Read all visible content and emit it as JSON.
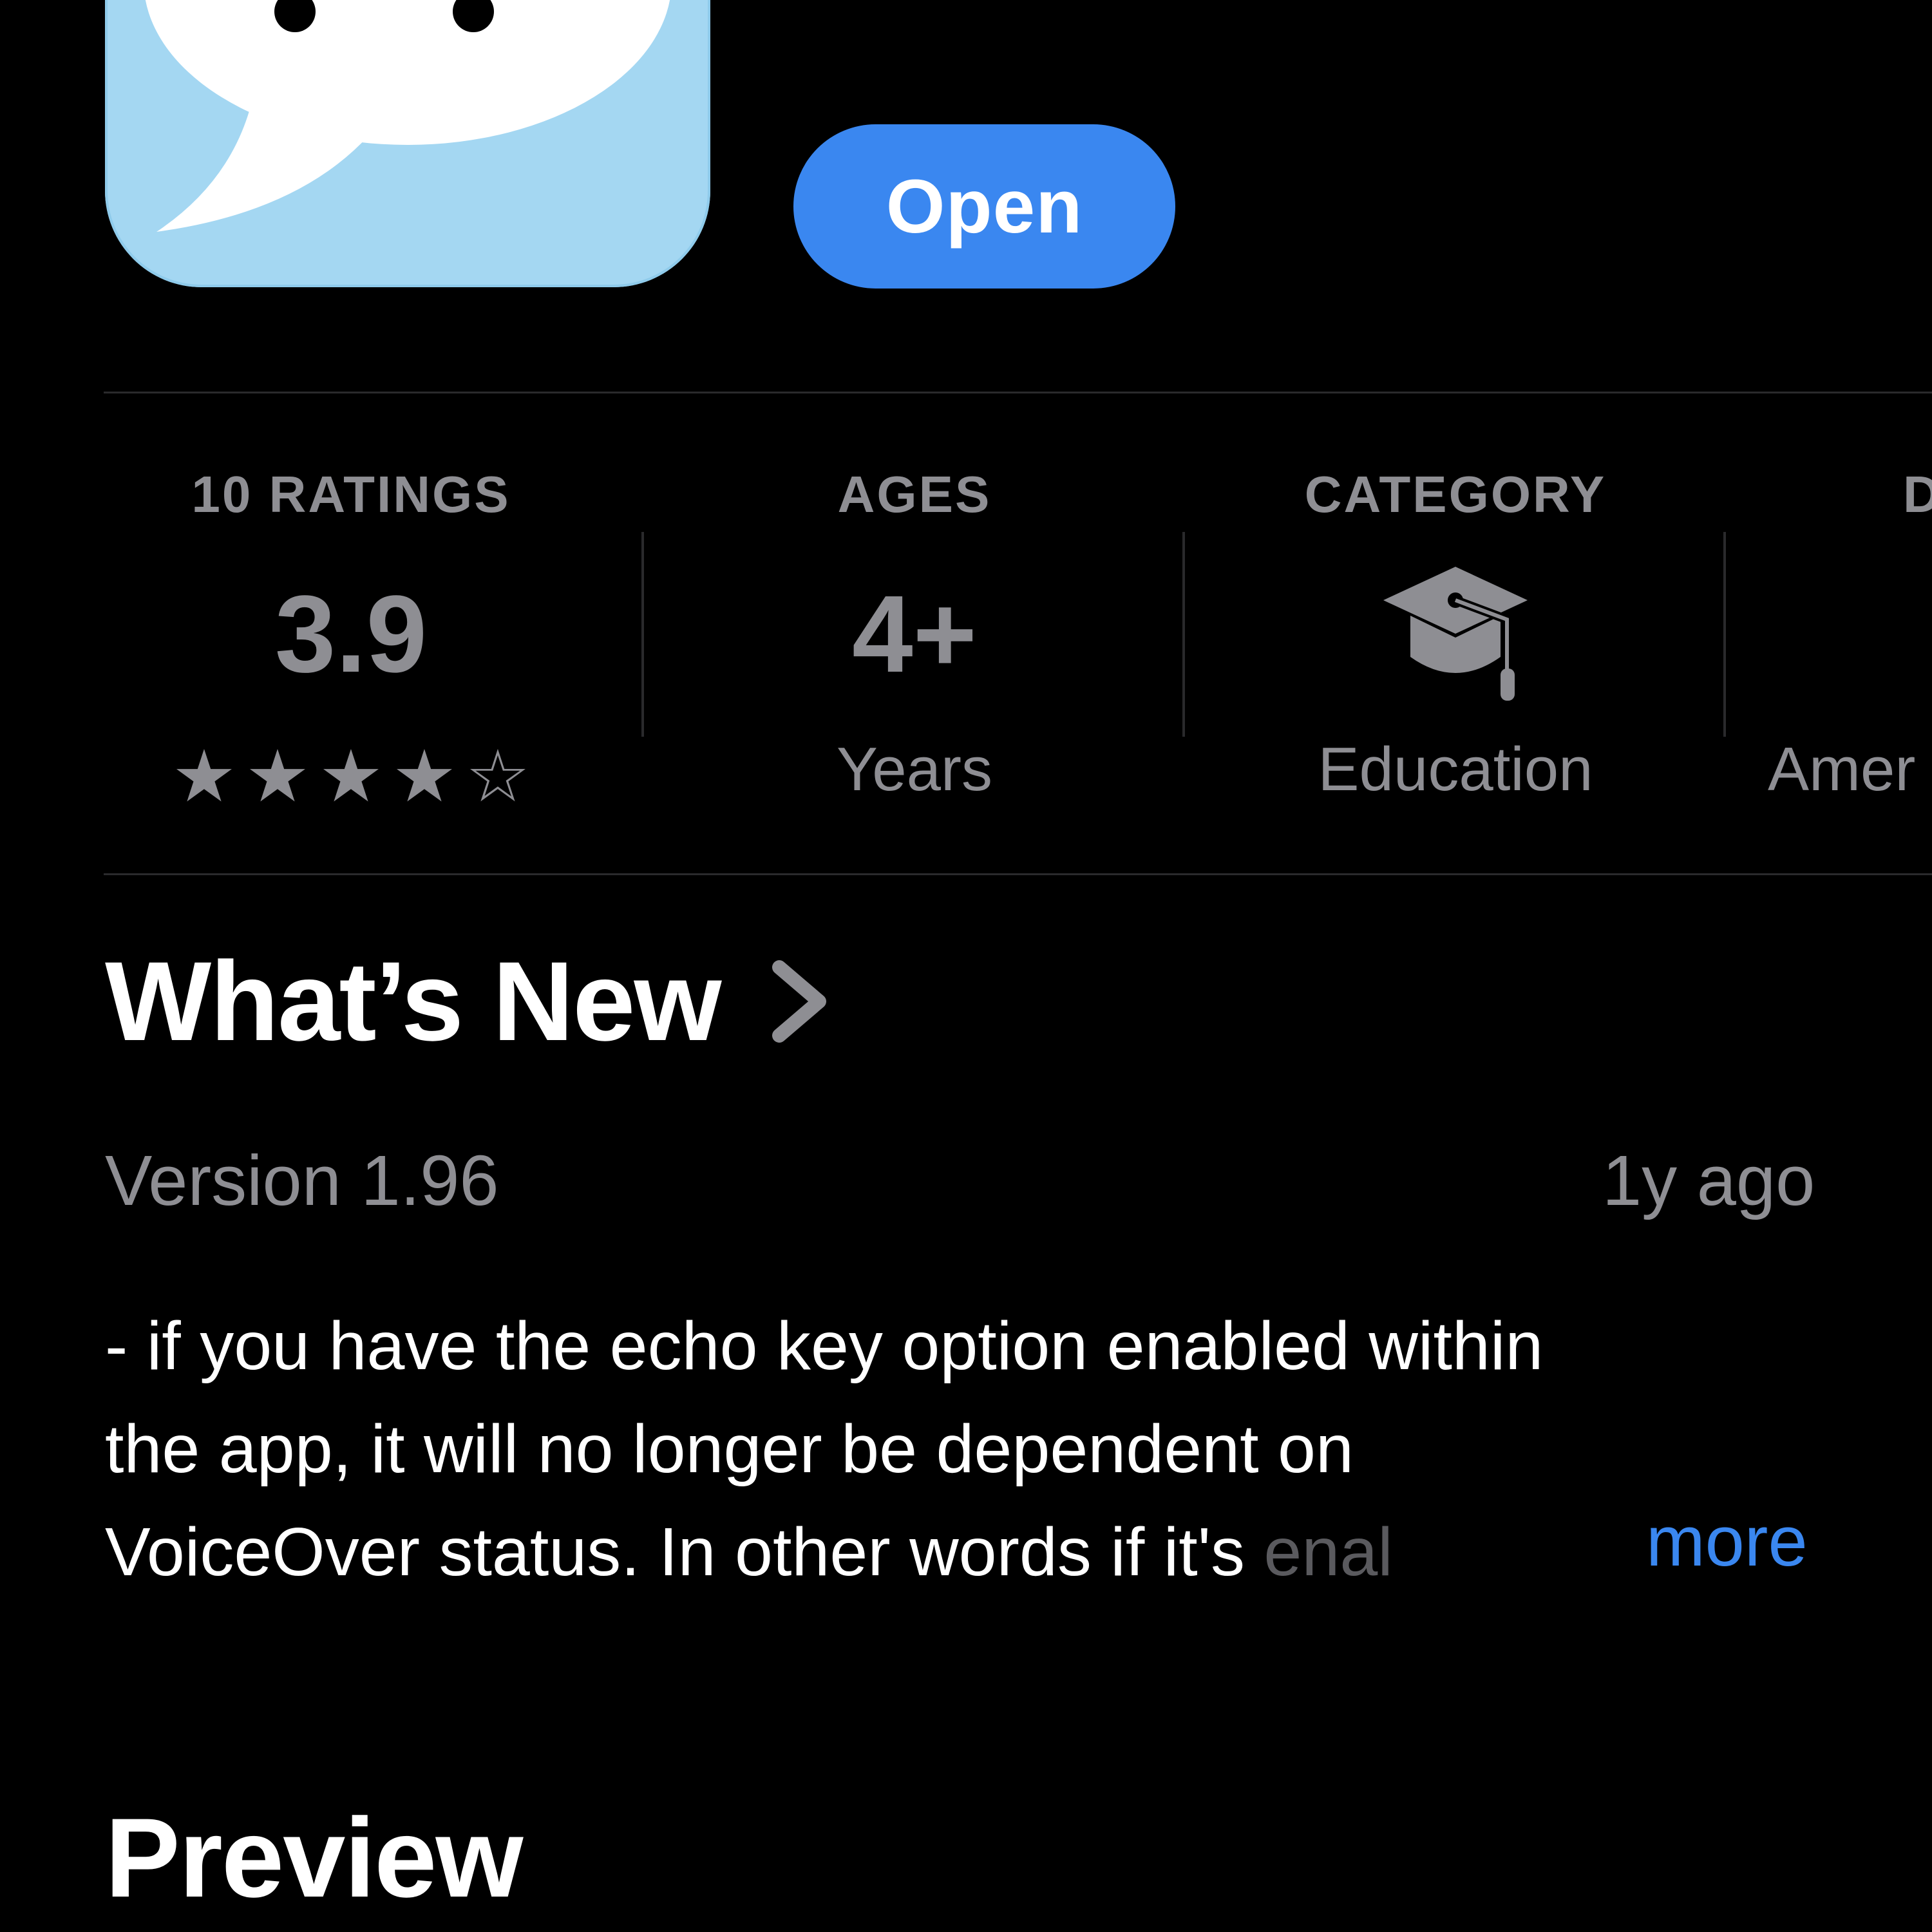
{
  "app": {
    "open_label": "Open"
  },
  "info": {
    "ratings": {
      "header": "10 RATINGS",
      "value": "3.9",
      "stars_filled": 4,
      "stars_total": 5
    },
    "ages": {
      "header": "AGES",
      "value": "4+",
      "sub": "Years"
    },
    "category": {
      "header": "CATEGORY",
      "icon": "graduation-cap-icon",
      "sub": "Education"
    },
    "developer": {
      "header": "D",
      "sub": "Amer"
    }
  },
  "whats_new": {
    "title": "What’s New",
    "version": "Version 1.96",
    "age": "1y ago",
    "notes": {
      "line1": "- if you have the echo key option enabled within",
      "line2": "the app, it will no longer be dependent on",
      "line3": "VoiceOver status. In other words if it's ",
      "line3_fade": "enal"
    },
    "more_label": "more"
  },
  "preview": {
    "title": "Preview"
  },
  "colors": {
    "background": "#000000",
    "accent": "#3a87f0",
    "secondary_text": "#8e8e93",
    "icon_background": "#a4d7f2"
  }
}
